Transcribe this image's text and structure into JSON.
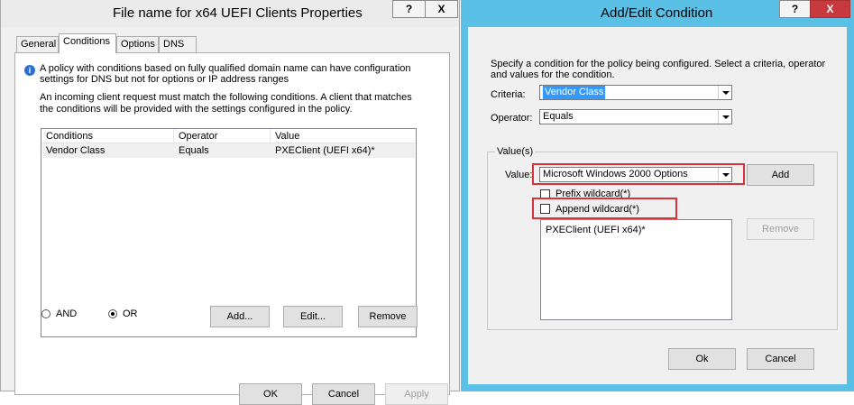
{
  "left_window": {
    "title": "File name for x64 UEFI Clients Properties",
    "help_button": "?",
    "close_button": "X",
    "tabs": [
      "General",
      "Conditions",
      "Options",
      "DNS"
    ],
    "active_tab": "Conditions",
    "info_text_1": "A policy with conditions based on fully qualified domain name can have configuration",
    "info_text_2": "settings for DNS but not for options or IP address ranges",
    "desc_text_1": "An incoming client request must match the following conditions. A client that matches",
    "desc_text_2": "the conditions will be provided with the settings configured in the policy.",
    "columns": [
      "Conditions",
      "Operator",
      "Value"
    ],
    "rows": [
      {
        "condition": "Vendor Class",
        "operator": "Equals",
        "value": "PXEClient (UEFI x64)*"
      }
    ],
    "radio_and": "AND",
    "radio_or": "OR",
    "selected_radio": "OR",
    "add_button": "Add...",
    "edit_button": "Edit...",
    "remove_button": "Remove",
    "ok_button": "OK",
    "cancel_button": "Cancel",
    "apply_button": "Apply"
  },
  "right_window": {
    "title": "Add/Edit Condition",
    "help_button": "?",
    "close_button": "X",
    "intro_1": "Specify a condition for the policy being configured. Select a criteria, operator",
    "intro_2": "and values for the condition.",
    "criteria_label": "Criteria:",
    "criteria_value": "Vendor Class",
    "operator_label": "Operator:",
    "operator_value": "Equals",
    "values_group": "Value(s)",
    "value_label": "Value:",
    "value_selected": "Microsoft Windows 2000 Options",
    "add_button": "Add",
    "prefix_wildcard": "Prefix wildcard(*)",
    "append_wildcard": "Append wildcard(*)",
    "value_list": [
      "PXEClient (UEFI x64)*"
    ],
    "remove_button": "Remove",
    "ok_button": "Ok",
    "cancel_button": "Cancel"
  },
  "colors": {
    "highlight": "#d9323a",
    "selection": "#3399ff",
    "titlebar_active": "#5bc0e6",
    "close_red": "#c7393c"
  }
}
